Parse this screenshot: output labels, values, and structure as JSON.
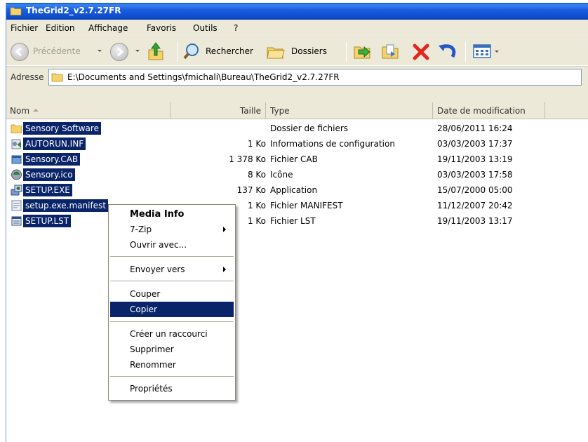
{
  "window": {
    "title": "TheGrid2_v2.7.27FR"
  },
  "menubar": [
    "Fichier",
    "Edition",
    "Affichage",
    "Favoris",
    "Outils",
    "?"
  ],
  "toolbar": {
    "back_label": "Précédente",
    "search_label": "Rechercher",
    "folders_label": "Dossiers"
  },
  "address": {
    "label": "Adresse",
    "path": "E:\\Documents and Settings\\fmichali\\Bureau\\TheGrid2_v2.7.27FR"
  },
  "columns": [
    "Nom",
    "Taille",
    "Type",
    "Date de modification"
  ],
  "files": [
    {
      "name": "Sensory Software",
      "size": "",
      "type": "Dossier de fichiers",
      "date": "28/06/2011 16:24",
      "icon": "folder-icon"
    },
    {
      "name": "AUTORUN.INF",
      "size": "1 Ko",
      "type": "Informations de configuration",
      "date": "03/03/2003 17:37",
      "icon": "config-file-icon"
    },
    {
      "name": "Sensory.CAB",
      "size": "1 378 Ko",
      "type": "Fichier CAB",
      "date": "19/11/2003 13:19",
      "icon": "cab-file-icon"
    },
    {
      "name": "Sensory.ico",
      "size": "8 Ko",
      "type": "Icône",
      "date": "03/03/2003 17:58",
      "icon": "ico-file-icon"
    },
    {
      "name": "SETUP.EXE",
      "size": "137 Ko",
      "type": "Application",
      "date": "15/07/2000 05:00",
      "icon": "setup-exe-icon"
    },
    {
      "name": "setup.exe.manifest",
      "size": "1 Ko",
      "type": "Fichier MANIFEST",
      "date": "11/12/2007 20:42",
      "icon": "manifest-file-icon"
    },
    {
      "name": "SETUP.LST",
      "size": "1 Ko",
      "type": "Fichier LST",
      "date": "19/11/2003 13:17",
      "icon": "lst-file-icon"
    }
  ],
  "context_menu": {
    "media_info": "Media Info",
    "zip": "7-Zip",
    "open_with": "Ouvrir avec...",
    "send_to": "Envoyer vers",
    "cut": "Couper",
    "copy": "Copier",
    "create_shortcut": "Créer un raccourci",
    "delete": "Supprimer",
    "rename": "Renommer",
    "properties": "Propriétés",
    "highlighted": "Copier"
  },
  "colors": {
    "selection": "#0a246a",
    "titlebar": "#0d4ccc",
    "chrome": "#ece9d8"
  }
}
